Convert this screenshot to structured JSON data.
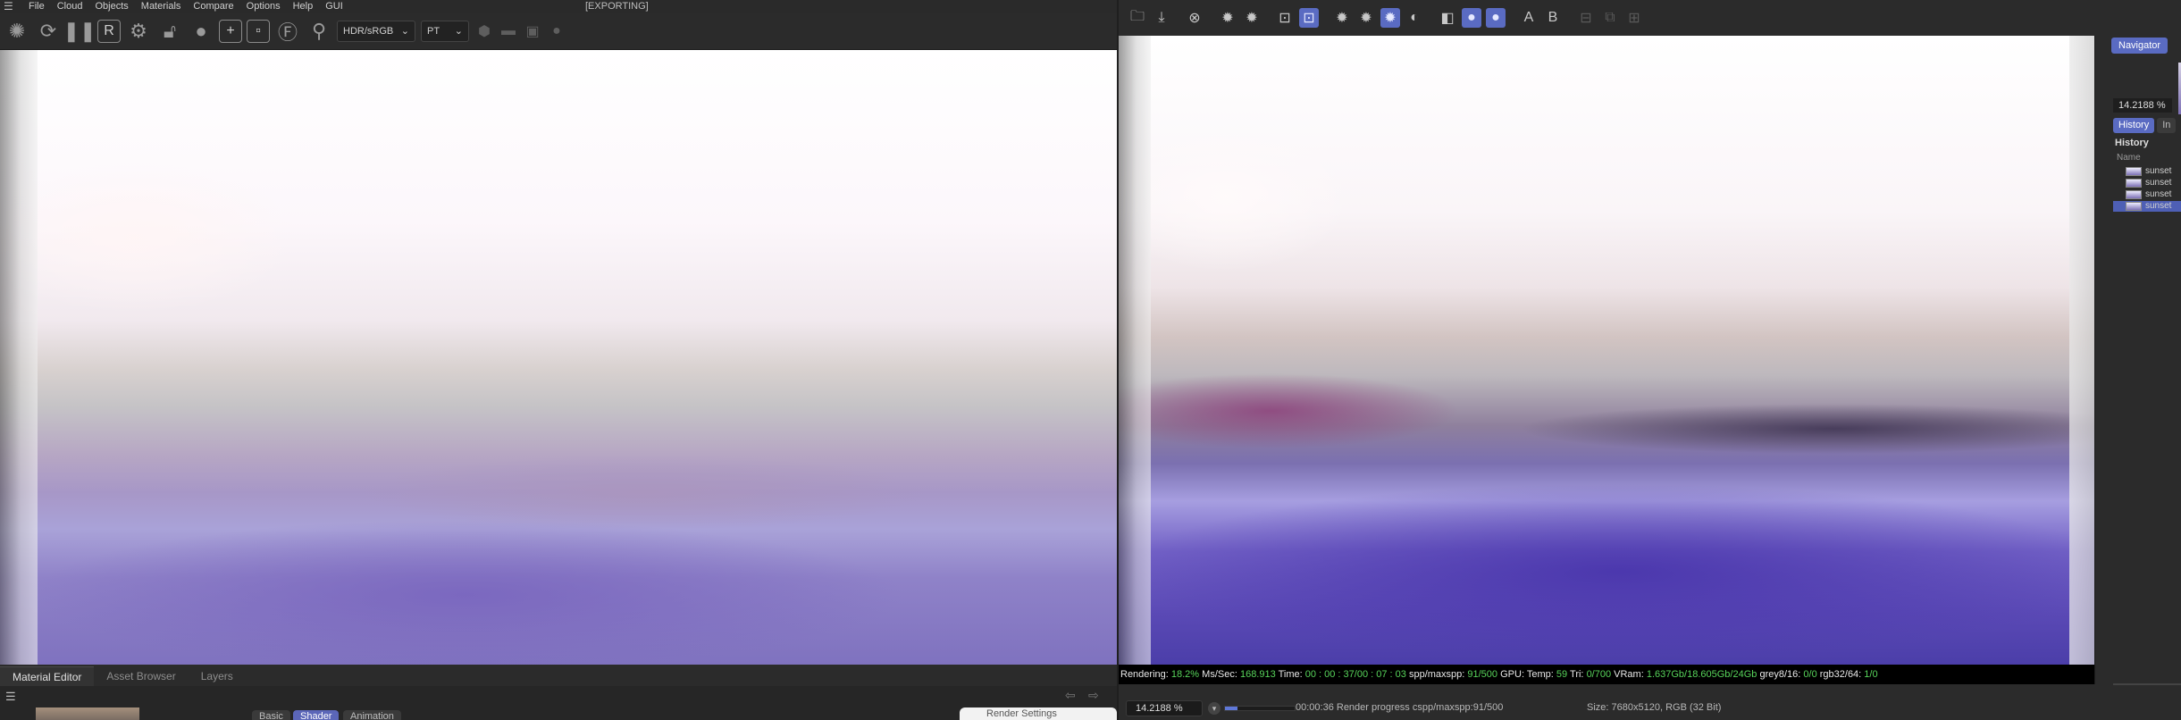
{
  "app": {
    "menu": [
      "File",
      "Cloud",
      "Objects",
      "Materials",
      "Compare",
      "Options",
      "Help",
      "GUI"
    ],
    "export_status": "[EXPORTING]",
    "colorspace_select": "HDR/sRGB",
    "render_mode_select": "PT"
  },
  "material_editor": {
    "tabs": [
      "Material Editor",
      "Asset Browser",
      "Layers"
    ],
    "sub_tabs": [
      "Basic",
      "Shader",
      "Animation"
    ],
    "active_sub_tab": "Shader",
    "render_settings_tab": "Render Settings"
  },
  "render_window": {
    "status": {
      "rendering_label": "Rendering:",
      "rendering_pct": "18.2%",
      "mssec_label": "Ms/Sec:",
      "mssec": "168.913",
      "time_label": "Time:",
      "time": "00 : 00 : 37/00 : 07 : 03",
      "spp_label": "spp/maxspp:",
      "spp": "91/500",
      "gpu_label": "GPU:",
      "temp_label": "Temp:",
      "temp": "59",
      "tri_label": "Tri:",
      "tri": "0/700",
      "vram_label": "VRam:",
      "vram": "1.637Gb/18.605Gb/24Gb",
      "grey_label": "grey8/16:",
      "grey": "0/0",
      "rgb_label": "rgb32/64:",
      "rgb": "1/0"
    },
    "zoom": "14.2188 %",
    "progress_text": "00:00:36 Render progress  cspp/maxspp:91/500",
    "progress_fraction": 0.182,
    "size_text": "Size: 7680x5120, RGB (32 Bit)",
    "text_buttons": [
      "A",
      "B"
    ]
  },
  "side_panel": {
    "navigator_label": "Navigator",
    "zoom": "14.2188 %",
    "tabs": [
      "History",
      "In"
    ],
    "history_title": "History",
    "column_name": "Name",
    "history_items": [
      "sunset",
      "sunset",
      "sunset",
      "sunset"
    ],
    "selected_index": 3
  },
  "colors": {
    "accent": "#5a6bc2",
    "status_green": "#57d35a",
    "bg": "#2b2b2b"
  }
}
